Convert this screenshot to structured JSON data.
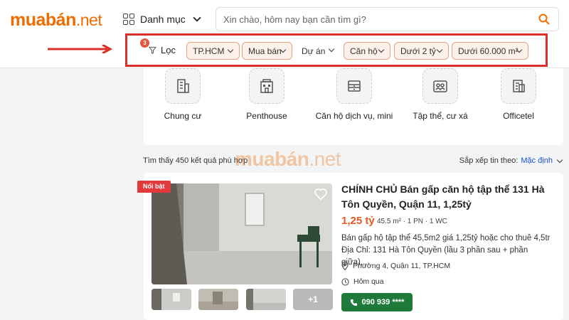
{
  "header": {
    "logo_main": "muabán",
    "logo_suffix": ".net",
    "category_label": "Danh mục",
    "search_placeholder": "Xin chào, hôm nay bạn cần tìm gì?"
  },
  "filter": {
    "count": "3",
    "label": "Lọc",
    "chips": [
      "TP.HCM",
      "Mua bán",
      "Dự án",
      "Căn hộ",
      "Dưới 2 tỷ",
      "Dưới 60.000 m²"
    ]
  },
  "property_types": [
    {
      "label": "Chung cư",
      "icon": "apartment-icon"
    },
    {
      "label": "Penthouse",
      "icon": "penthouse-icon"
    },
    {
      "label": "Căn hộ dịch vụ, mini",
      "icon": "serviced-apartment-icon"
    },
    {
      "label": "Tập thể, cư xá",
      "icon": "collective-housing-icon"
    },
    {
      "label": "Officetel",
      "icon": "officetel-icon"
    }
  ],
  "results": {
    "count_text": "Tìm thấy 450 kết quả phù hợp",
    "sort_label": "Sắp xếp tin theo:",
    "sort_value": "Mặc định"
  },
  "watermark": {
    "main": "muabán",
    "suffix": ".net"
  },
  "listing": {
    "badge": "Nổi bật",
    "title": "CHÍNH CHỦ Bán gấp căn hộ tập thể 131 Hà Tôn Quyền, Quận 11, 1,25tỷ",
    "price": "1,25 tỷ",
    "specs": "45.5 m² · 1 PN · 1 WC",
    "description": "Bán gấp hộ tập thể 45,5m2 giá 1,25tỷ hoặc cho thuê 4,5tr Địa Chỉ: 131 Hà Tôn Quyền (lầu 3 phần sau + phần giữa),...",
    "location": "Phường 4, Quận 11, TP.HCM",
    "posted": "Hôm qua",
    "phone": "090 939 ****",
    "more_photos": "+1"
  },
  "colors": {
    "brand": "#ef6c00",
    "highlight_border": "#d9302b",
    "phone_button": "#1f7a3a",
    "price": "#e0591e"
  }
}
